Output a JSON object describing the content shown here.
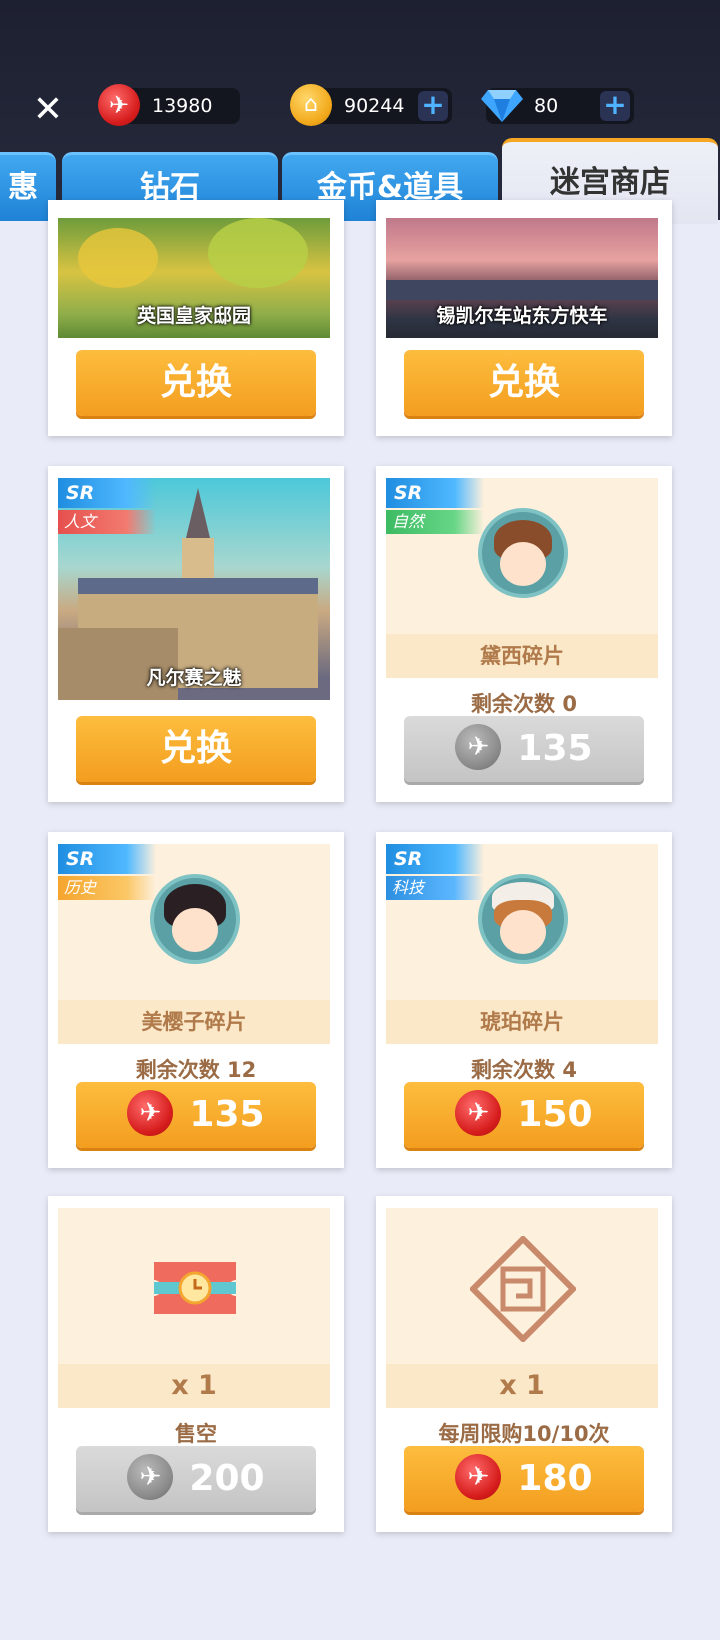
{
  "resources": {
    "ticket": {
      "value": "13980",
      "icon": "red-plane-coin-icon"
    },
    "gold": {
      "value": "90244",
      "icon": "gold-house-coin-icon"
    },
    "diamond": {
      "value": "80",
      "icon": "diamond-icon"
    },
    "plus": "+"
  },
  "close_label": "✕",
  "tabs": [
    {
      "label": "惠"
    },
    {
      "label": "钻石"
    },
    {
      "label": "金币&道具"
    },
    {
      "label": "迷宫商店"
    }
  ],
  "items": [
    {
      "caption": "英国皇家邸园",
      "button": "兑换"
    },
    {
      "caption": "锡凯尔车站东方快车",
      "button": "兑换"
    },
    {
      "rarity": "SR",
      "category": "人文",
      "caption": "凡尔赛之魅",
      "button": "兑换"
    },
    {
      "rarity": "SR",
      "category": "自然",
      "name": "黛西碎片",
      "status": "剩余次数 0",
      "price": "135",
      "state": "disabled"
    },
    {
      "rarity": "SR",
      "category": "历史",
      "name": "美樱子碎片",
      "status": "剩余次数 12",
      "price": "135",
      "state": "enabled"
    },
    {
      "rarity": "SR",
      "category": "科技",
      "name": "琥珀碎片",
      "status": "剩余次数 4",
      "price": "150",
      "state": "enabled"
    },
    {
      "quantity": "x 1",
      "status": "售空",
      "price": "200",
      "state": "disabled",
      "icon": "time-ticket-icon"
    },
    {
      "quantity": "x 1",
      "status": "每周限购10/10次",
      "price": "180",
      "state": "enabled",
      "icon": "maze-emblem-icon"
    }
  ]
}
